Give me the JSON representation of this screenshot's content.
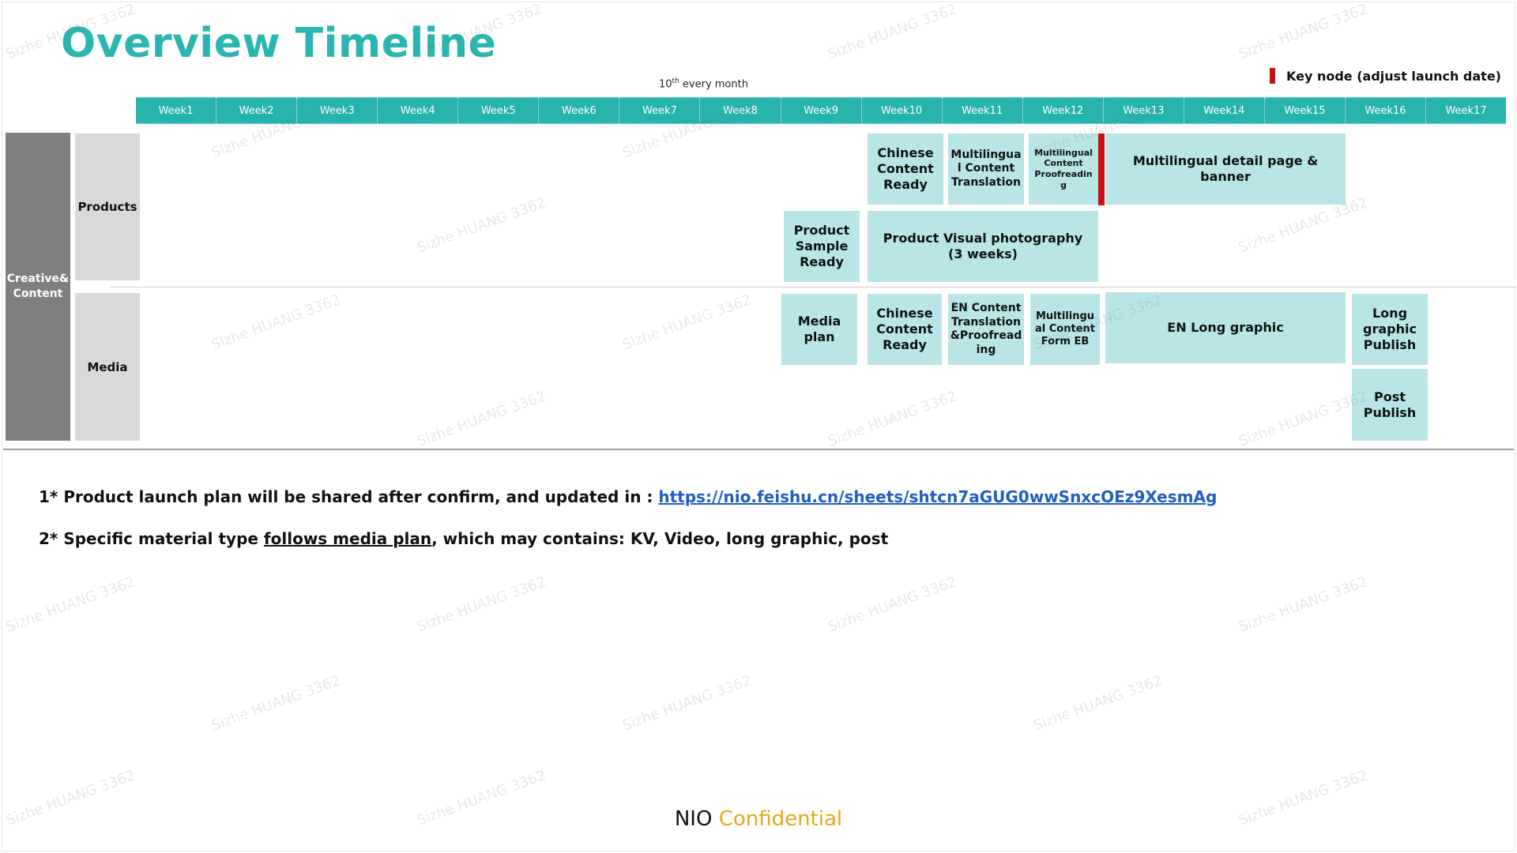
{
  "title": "Overview Timeline",
  "month_note": {
    "ordinal": "10",
    "sup": "th",
    "text": " every month"
  },
  "legend": {
    "label": "Key node (adjust launch date)",
    "color": "#cc1010"
  },
  "weeks": [
    "Week1",
    "Week2",
    "Week3",
    "Week4",
    "Week5",
    "Week6",
    "Week7",
    "Week8",
    "Week9",
    "Week10",
    "Week11",
    "Week12",
    "Week13",
    "Week14",
    "Week15",
    "Week16",
    "Week17"
  ],
  "categories": {
    "main": "Creative& Content",
    "products": "Products",
    "media": "Media"
  },
  "tasks": {
    "p_chinese_ready": "Chinese Content Ready",
    "p_multi_translation": "Multilingua l Content Translation",
    "p_multi_proofreading": "Multilingual Content Proofreadin g",
    "p_multi_detail": "Multilingual detail page & banner",
    "p_sample_ready": "Product Sample Ready",
    "p_visual_photo_line1": "Product Visual  photography",
    "p_visual_photo_line2": "(3 weeks)",
    "m_media_plan": "Media plan",
    "m_chinese_ready": "Chinese Content Ready",
    "m_en_translation": "EN Content Translation &Proofread ing",
    "m_multi_form_eb": "Multilingu al Content Form EB",
    "m_en_long_graphic": "EN Long graphic",
    "m_long_graphic_publish": "Long graphic Publish",
    "m_post_publish": "Post Publish"
  },
  "notes": {
    "note1_prefix": "1* Product launch plan will be shared after confirm, and updated in : ",
    "note1_link": "https://nio.feishu.cn/sheets/shtcn7aGUG0wwSnxcOEz9XesmAg",
    "note2_prefix": "2* Specific material type ",
    "note2_emph": "follows media plan",
    "note2_suffix": ", which may contains: KV, Video, long graphic, post"
  },
  "footer": {
    "brand": "NIO ",
    "confidential": "Confidential"
  },
  "watermark": "Sizhe HUANG 3362",
  "colors": {
    "accent_teal": "#25b3ac",
    "title_teal": "#2bb5b0",
    "task_fill": "#b9e5e7",
    "category_gray": "#7f7f7f",
    "subcategory_gray": "#d9d9d9",
    "key_node_red": "#cc1010",
    "confidential_gold": "#e6a817",
    "link_blue": "#1f5fbf"
  }
}
